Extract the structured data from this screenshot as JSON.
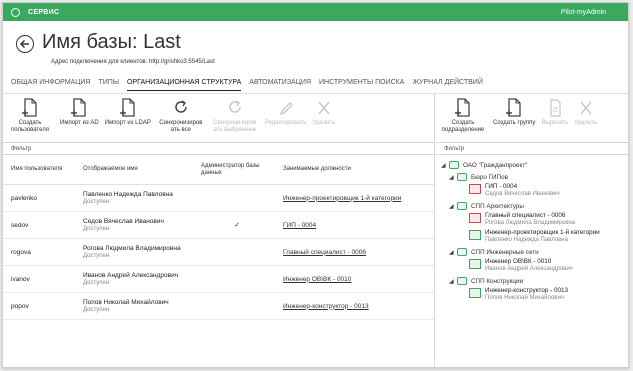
{
  "titlebar": {
    "app": "СЕРВИС",
    "user": "Pilot-myAdmin"
  },
  "header": {
    "title": "Имя базы: Last",
    "subtitle": "Адрес подключения для клиентов: http://grishko3:5545/Last"
  },
  "tabs": [
    {
      "label": "ОБЩАЯ ИНФОРМАЦИЯ"
    },
    {
      "label": "ТИПЫ"
    },
    {
      "label": "ОРГАНИЗАЦИОННАЯ СТРУКТУРА",
      "active": true
    },
    {
      "label": "АВТОМАТИЗАЦИЯ"
    },
    {
      "label": "ИНСТРУМЕНТЫ ПОИСКА"
    },
    {
      "label": "ЖУРНАЛ ДЕЙСТВИЙ"
    }
  ],
  "left_toolbar": [
    {
      "label": "Создать пользователя",
      "icon": "add-document-icon",
      "disabled": false
    },
    {
      "label": "Импорт из AD",
      "icon": "add-document-icon",
      "disabled": false
    },
    {
      "label": "Импорт из LDAP",
      "icon": "add-document-icon",
      "disabled": false
    },
    {
      "label": "Синхронизиров ать все",
      "icon": "sync-icon",
      "disabled": false
    },
    {
      "label": "Синхронизиров ать выбранные",
      "icon": "sync-icon",
      "disabled": true
    },
    {
      "label": "Редактировать",
      "icon": "pencil-icon",
      "disabled": true
    },
    {
      "label": "Удалить",
      "icon": "close-icon",
      "disabled": true
    }
  ],
  "right_toolbar": [
    {
      "label": "Создать подразделение",
      "icon": "add-document-icon",
      "disabled": false
    },
    {
      "label": "Создать группу",
      "icon": "add-document-icon",
      "disabled": false
    },
    {
      "label": "Вырезать",
      "icon": "cut-icon",
      "disabled": true
    },
    {
      "label": "Удалить",
      "icon": "close-icon",
      "disabled": true
    }
  ],
  "filter_placeholder": "Фильтр",
  "users_table": {
    "columns": [
      "Имя пользователя",
      "Отображаемое имя",
      "Администратор базы данных",
      "Занимаемые должности"
    ],
    "rows": [
      {
        "login": "pavlenko",
        "name": "Павленко Надежда Павловна",
        "status": "Доступен",
        "admin": "",
        "position": "Инженер-проектировщик 1-й категории"
      },
      {
        "login": "sedov",
        "name": "Седов Вячеслав Иванович",
        "status": "Доступен",
        "admin": "✓",
        "position": "ГИП - 0004"
      },
      {
        "login": "rogova",
        "name": "Рогова Людмила Владимировна",
        "status": "Доступен",
        "admin": "",
        "position": "Главный специалист - 0006"
      },
      {
        "login": "ivanov",
        "name": "Иванов Андрей Александрович",
        "status": "Доступен",
        "admin": "",
        "position": "Инженер ОВ\\ВК - 0010"
      },
      {
        "login": "popov",
        "name": "Попов Николай Михайлович",
        "status": "Доступен",
        "admin": "",
        "position": "Инженер-конструктор - 0013"
      }
    ]
  },
  "org_tree": {
    "root": "ОАО \"Гражданпроект\"",
    "bureau": "Бюро ГИПов",
    "gip_pos": {
      "title": "ГИП - 0004",
      "person": "Седов Вячеслав Иванович"
    },
    "dept_arch": "СПП Архитектуры",
    "arch_positions": [
      {
        "title": "Главный специалист - 0006",
        "person": "Рогова Людмила Владимировна",
        "red": true
      },
      {
        "title": "Инженер-проектировщик 1-й категории",
        "person": "Павленко Надежда Павловна",
        "red": false
      }
    ],
    "dept_eng": "СПП Инженерные сети",
    "eng_pos": {
      "title": "Инженер ОВ\\ВК - 0010",
      "person": "Иванов Андрей Александрович"
    },
    "dept_constr": "СПП Конструкции",
    "constr_pos": {
      "title": "Инженер-конструктор - 0013",
      "person": "Попов Николай Михайлович"
    }
  }
}
